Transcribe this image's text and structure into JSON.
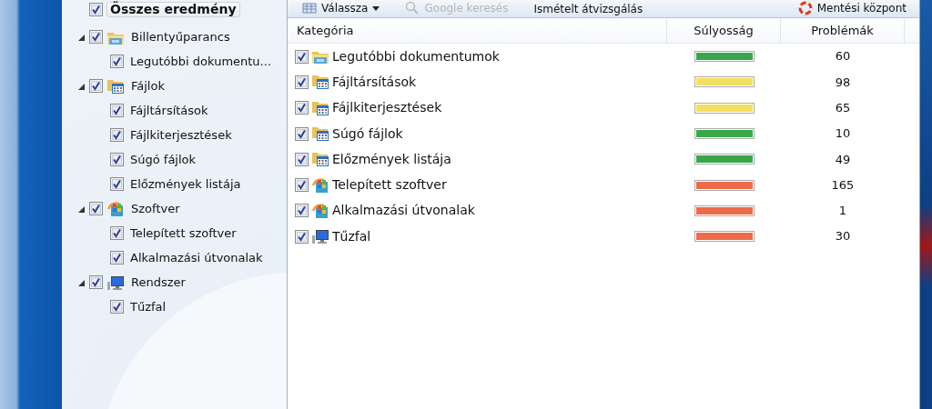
{
  "tree": {
    "label": "Összes eredmény",
    "checked": true,
    "selected": true,
    "children": [
      {
        "label": "Billentyűparancs",
        "kind": "shortcut",
        "checked": true,
        "expanded": true,
        "children": [
          {
            "label": "Legutóbbi dokumentu...",
            "checked": true
          }
        ]
      },
      {
        "label": "Fájlok",
        "kind": "files",
        "checked": true,
        "expanded": true,
        "children": [
          {
            "label": "Fájltársítások",
            "checked": true
          },
          {
            "label": "Fájlkiterjesztések",
            "checked": true
          },
          {
            "label": "Súgó fájlok",
            "checked": true
          },
          {
            "label": "Előzmények listája",
            "checked": true
          }
        ]
      },
      {
        "label": "Szoftver",
        "kind": "software",
        "checked": true,
        "expanded": true,
        "children": [
          {
            "label": "Telepített szoftver",
            "checked": true
          },
          {
            "label": "Alkalmazási útvonalak",
            "checked": true
          }
        ]
      },
      {
        "label": "Rendszer",
        "kind": "system",
        "checked": true,
        "expanded": true,
        "children": [
          {
            "label": "Tűzfal",
            "checked": true
          }
        ]
      }
    ]
  },
  "toolbar": {
    "left": [
      {
        "label": "Válassza",
        "kind": "menu",
        "disabled": false
      },
      {
        "label": "Google keresés",
        "kind": "search",
        "disabled": true
      },
      {
        "label": "Ismételt átvizsgálás",
        "kind": "plain",
        "disabled": false
      }
    ],
    "right": [
      {
        "label": "Mentési központ",
        "kind": "rescue",
        "disabled": false
      }
    ]
  },
  "table": {
    "columns": [
      "Kategória",
      "Súlyosság",
      "Problémák"
    ],
    "rows": [
      {
        "category": "Legutóbbi dokumentumok",
        "kind": "shortcut",
        "checked": true,
        "color": "#3aa64c",
        "problems": "60"
      },
      {
        "category": "Fájltársítások",
        "kind": "files",
        "checked": true,
        "color": "#f2e060",
        "problems": "98"
      },
      {
        "category": "Fájlkiterjesztések",
        "kind": "files",
        "checked": true,
        "color": "#f2e060",
        "problems": "65"
      },
      {
        "category": "Súgó fájlok",
        "kind": "files",
        "checked": true,
        "color": "#3aa64c",
        "problems": "10"
      },
      {
        "category": "Előzmények listája",
        "kind": "files",
        "checked": true,
        "color": "#3aa64c",
        "problems": "49"
      },
      {
        "category": "Telepített szoftver",
        "kind": "software",
        "checked": true,
        "color": "#ee6a48",
        "problems": "165"
      },
      {
        "category": "Alkalmazási útvonalak",
        "kind": "software",
        "checked": true,
        "color": "#ee6a48",
        "problems": "1"
      },
      {
        "category": "Tűzfal",
        "kind": "system",
        "checked": true,
        "color": "#ee6a48",
        "problems": "30"
      }
    ]
  }
}
